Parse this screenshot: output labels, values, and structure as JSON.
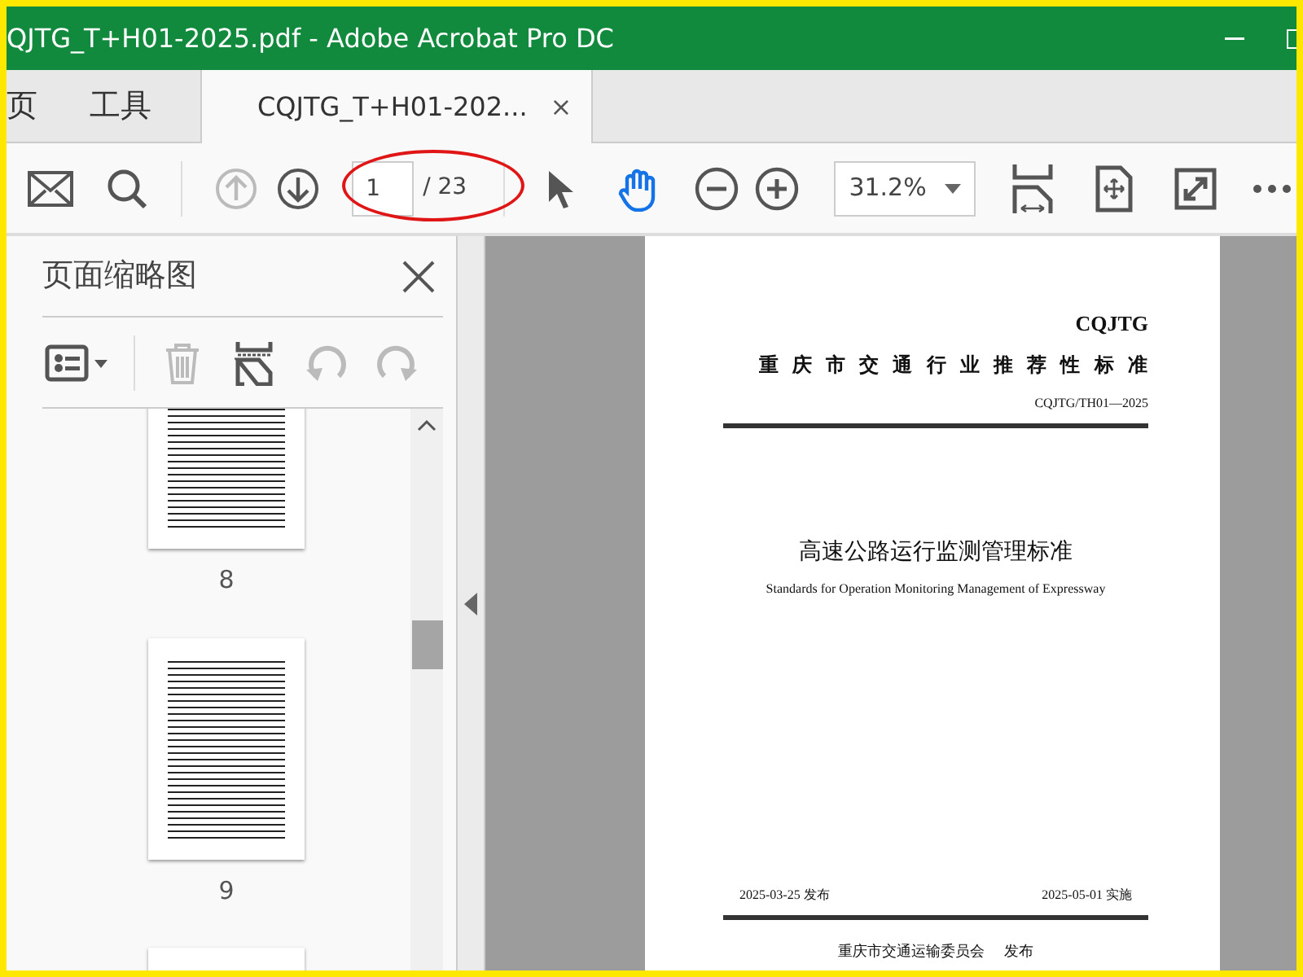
{
  "window": {
    "title": "QJTG_T+H01-2025.pdf - Adobe Acrobat Pro DC"
  },
  "tabs": [
    {
      "label": "页",
      "selected": false
    },
    {
      "label": "工具",
      "selected": false
    },
    {
      "label": "CQJTG_T+H01-202...",
      "selected": true,
      "close": "×"
    }
  ],
  "toolbar": {
    "prev_disabled": true,
    "next_disabled": false,
    "page_value": "1",
    "page_total": "/ 23",
    "tools": [
      {
        "kind": "select",
        "selected": false
      },
      {
        "kind": "hand",
        "selected": true
      }
    ],
    "zoom_value": "31.2%"
  },
  "sidebar": {
    "title": "页面缩略图",
    "thumbnails": [
      {
        "kind": "page",
        "label": "8"
      },
      {
        "kind": "page",
        "label": "9"
      },
      {
        "kind": "page"
      }
    ]
  },
  "document": {
    "org": "CQJTG",
    "heading": "重庆市交通行业推荐性标准",
    "code": "CQJTG/TH01—2025",
    "title_cn": "高速公路运行监测管理标准",
    "title_en": "Standards for Operation Monitoring Management of Expressway",
    "publish_date": "2025-03-25 发布",
    "effective_date": "2025-05-01 实施",
    "publisher": "重庆市交通运输委员会",
    "publisher_action": "发布"
  }
}
